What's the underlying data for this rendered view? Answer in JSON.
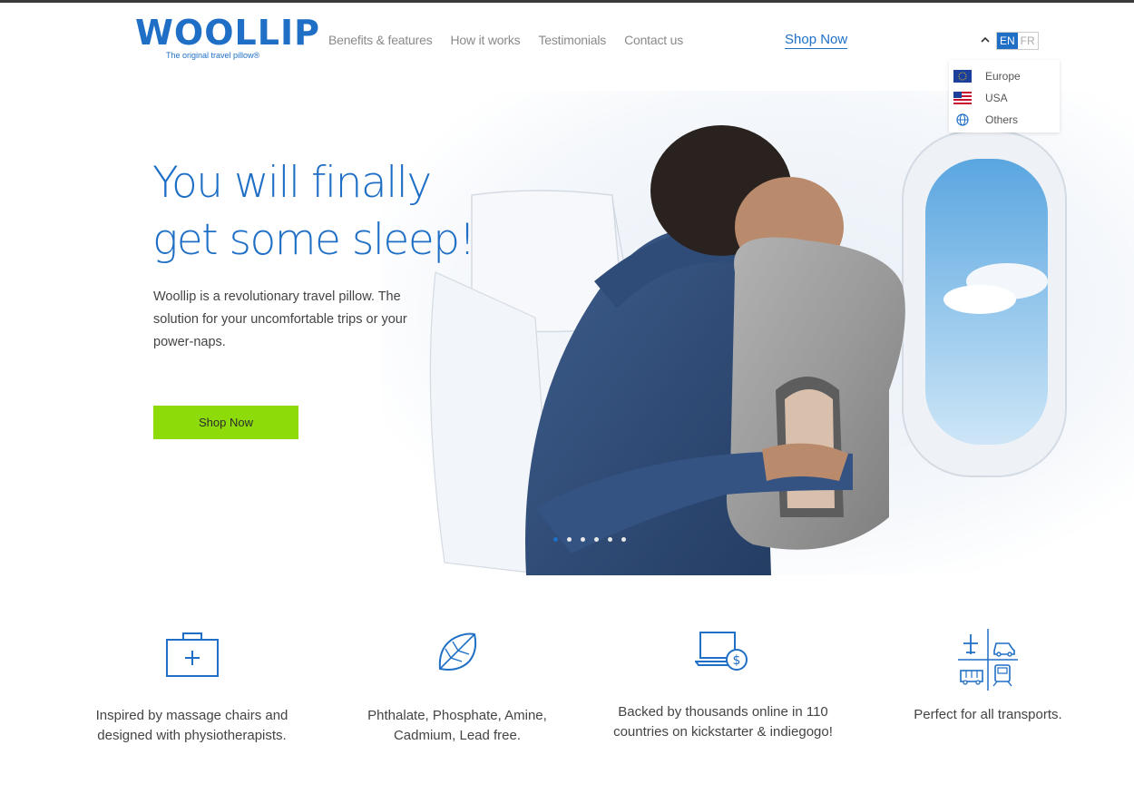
{
  "brand": {
    "name": "WOOLLIP",
    "tagline": "The original travel pillow®",
    "color": "#1f6fc6"
  },
  "nav": {
    "items": [
      "Benefits & features",
      "How it works",
      "Testimonials",
      "Contact us"
    ],
    "shop_label": "Shop Now"
  },
  "language": {
    "options": [
      "EN",
      "FR"
    ],
    "selected": "EN",
    "regions": [
      {
        "label": "Europe",
        "icon": "eu-flag-icon"
      },
      {
        "label": "USA",
        "icon": "us-flag-icon"
      },
      {
        "label": "Others",
        "icon": "globe-icon"
      }
    ]
  },
  "hero": {
    "title_line1": "You will finally",
    "title_line2": "get some sleep!",
    "description": "Woollip is a revolutionary travel pillow. The solution for your uncomfortable trips or your power-naps.",
    "cta_label": "Shop Now",
    "cta_color": "#8ddc0a",
    "slide_count": 6,
    "active_slide": 1
  },
  "features": [
    {
      "icon": "medical-kit-icon",
      "text": "Inspired by massage chairs and designed with physiotherapists."
    },
    {
      "icon": "leaf-icon",
      "text": "Phthalate, Phosphate, Amine, Cadmium, Lead free."
    },
    {
      "icon": "laptop-dollar-icon",
      "text": "Backed by thousands online in 110 countries on kickstarter & indiegogo!"
    },
    {
      "icon": "transports-icon",
      "text": "Perfect for all transports."
    }
  ]
}
